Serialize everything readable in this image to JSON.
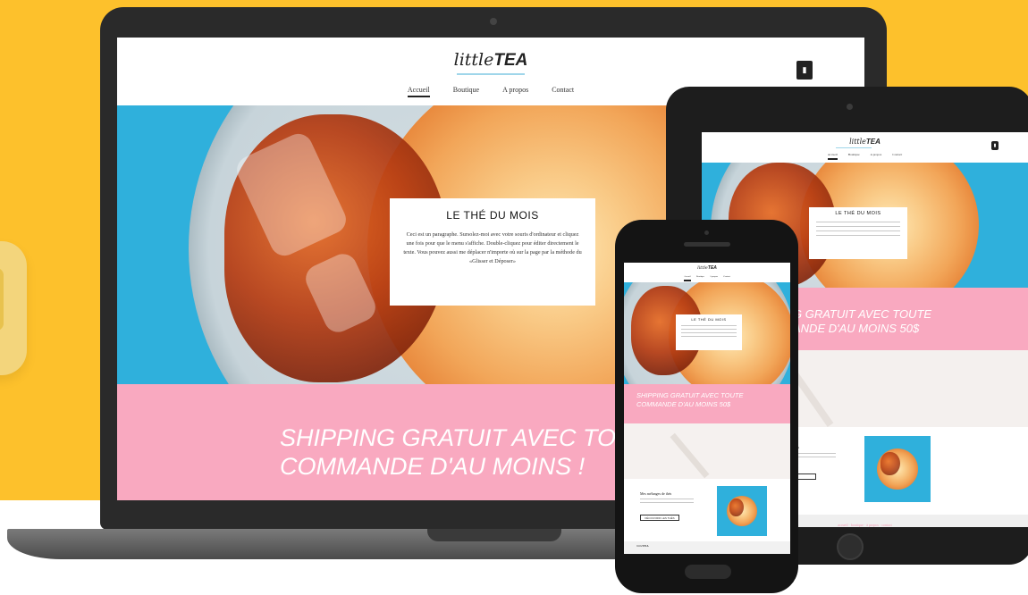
{
  "brand": {
    "logo_light": "little",
    "logo_bold": "TEA",
    "accent_color": "#9fd6ea",
    "background_color": "#fdc12c",
    "banner_color": "#f9a9c0"
  },
  "nav": {
    "items": [
      "Accueil",
      "Boutique",
      "A propos",
      "Contact"
    ],
    "active": "Accueil"
  },
  "cart_icon": "shopping-bag-icon",
  "feature_card": {
    "title": "LE THÉ DU MOIS",
    "body": "Ceci est un paragraphe. Sursolez-moi avec votre souris d'ordinateur et cliquez une fois pour que le menu s'affiche. Double-cliquez pour éditer directement le texte. Vous pouvez aussi me déplacer n'importe où sur la page par la méthode du «Glisser et Déposer»"
  },
  "laptop_banner": {
    "line1": "SHIPPING GRATUIT AVEC TO",
    "line2": "COMMANDE D'AU MOINS !"
  },
  "tablet_banner": {
    "line1": "G GRATUIT AVEC TOUTE",
    "line2": "ANDE D'AU MOINS 50$"
  },
  "phone_banner": {
    "line1": "SHIPPING GRATUIT AVEC TOUTE",
    "line2": "COMMANDE D'AU MOINS 50$"
  },
  "blend_section": {
    "title": "Mes mélanges de thés",
    "tablet_title": "s thés",
    "button": "DÉCOUVRIR LES THÉS"
  },
  "tablet_footer": {
    "links": "accueil · boutique · à propos · contact"
  }
}
